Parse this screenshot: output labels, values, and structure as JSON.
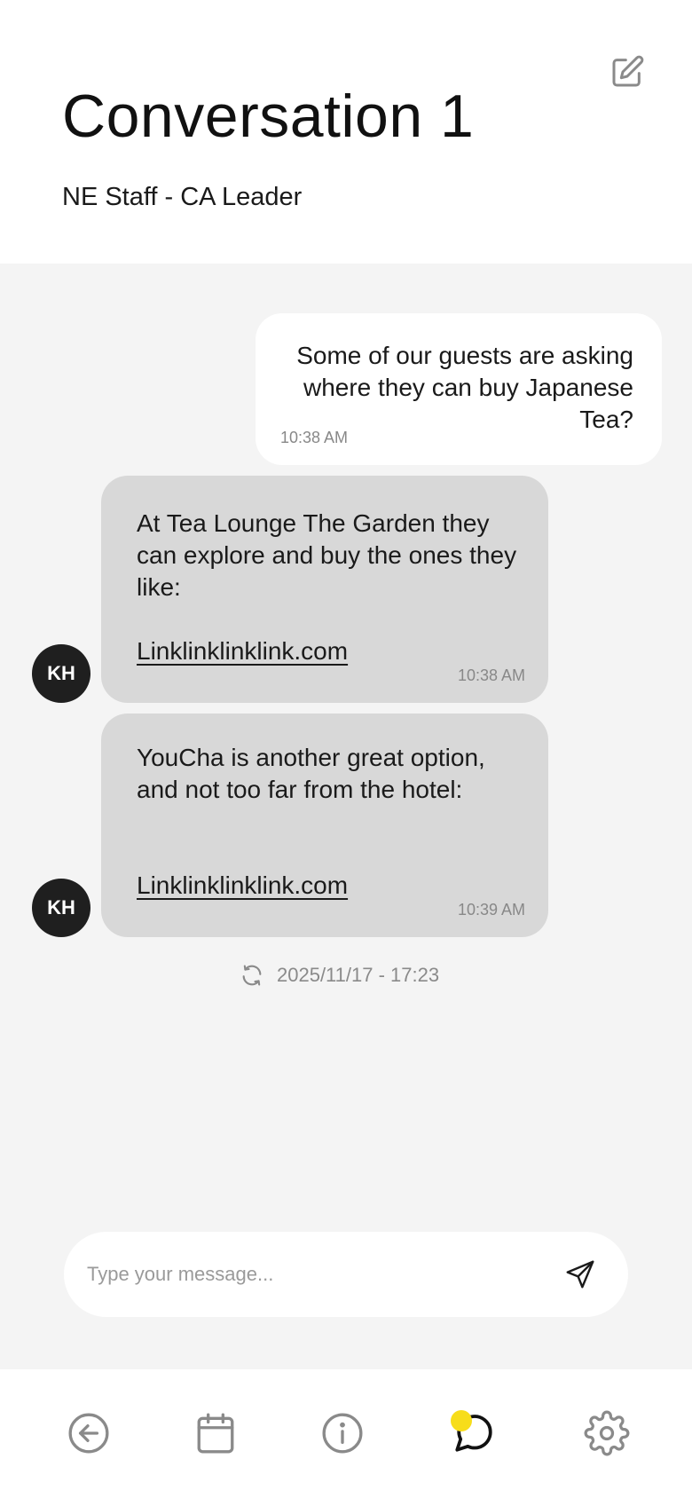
{
  "header": {
    "title": "Conversation 1",
    "subtitle": "NE Staff - CA Leader",
    "edit_icon": "edit-square-icon"
  },
  "messages": [
    {
      "direction": "outgoing",
      "text": "Some of our guests are asking where they can buy Japanese Tea?",
      "time": "10:38 AM"
    },
    {
      "direction": "incoming",
      "avatar": "KH",
      "text": "At Tea Lounge The Garden they can explore and buy the ones they like:",
      "link": "Linklinklinklink.com",
      "time": "10:38 AM"
    },
    {
      "direction": "incoming",
      "avatar": "KH",
      "text": "YouCha is another great option, and not too far from the hotel:",
      "link": "Linklinklinklink.com",
      "time": "10:39 AM"
    }
  ],
  "sync": {
    "icon": "refresh-icon",
    "timestamp": "2025/11/17 - 17:23"
  },
  "composer": {
    "placeholder": "Type your message...",
    "value": "",
    "send_icon": "send-icon"
  },
  "bottom_nav": {
    "items": [
      {
        "icon": "back-circle-icon"
      },
      {
        "icon": "calendar-icon"
      },
      {
        "icon": "info-icon"
      },
      {
        "icon": "chat-icon",
        "active": true,
        "badge": true
      },
      {
        "icon": "settings-icon"
      }
    ],
    "badge_color": "#f7dd1a"
  },
  "colors": {
    "chat_background": "#f4f4f4",
    "incoming_bubble": "#d8d8d8",
    "outgoing_bubble": "#ffffff",
    "avatar": "#1f1f1f",
    "nav_icon": "#8a8a8a"
  }
}
